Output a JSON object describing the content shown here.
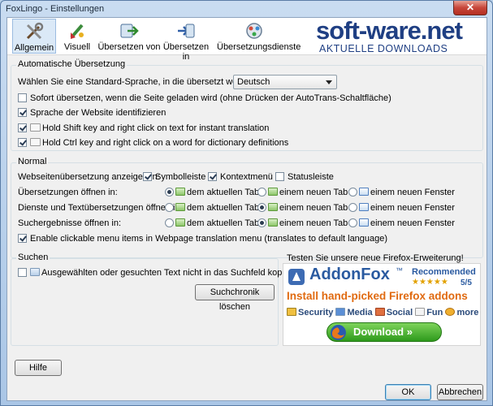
{
  "window": {
    "title": "FoxLingo - Einstellungen",
    "close_symbol": "✕"
  },
  "toolbar": {
    "items": [
      {
        "label": "Allgemein",
        "icon": "tools-icon"
      },
      {
        "label": "Visuell",
        "icon": "paint-brush-icon"
      },
      {
        "label": "Übersetzen von",
        "icon": "translate-from-icon"
      },
      {
        "label": "Übersetzen in",
        "icon": "translate-to-icon"
      },
      {
        "label": "Übersetzungsdienste",
        "icon": "services-icon"
      }
    ]
  },
  "brand": {
    "main": "soft-ware.net",
    "sub": "AKTUELLE DOWNLOADS"
  },
  "auto": {
    "legend": "Automatische Übersetzung",
    "default_lang_label": "Wählen Sie eine Standard-Sprache, in die übersetzt werden soll:",
    "default_lang_value": "Deutsch",
    "options": [
      {
        "label": "Sofort übersetzen, wenn die Seite geladen wird (ohne Drücken der AutoTrans-Schaltfläche)",
        "checked": false
      },
      {
        "label": "Sprache der Website identifizieren",
        "checked": true
      },
      {
        "label": "Hold Shift key and right click on text for instant translation",
        "checked": true
      },
      {
        "label": "Hold Ctrl key and right click on a word for dictionary definitions",
        "checked": true
      }
    ]
  },
  "normal": {
    "legend": "Normal",
    "web_label": "Webseitenübersetzung anzeigen in:",
    "web_options": [
      {
        "label": "Symbolleiste",
        "checked": true
      },
      {
        "label": "Kontextmenü",
        "checked": true
      },
      {
        "label": "Statusleiste",
        "checked": false
      }
    ],
    "radio_rows": [
      {
        "label": "Übersetzungen öffnen in:",
        "selected": 0
      },
      {
        "label": "Dienste und Textübersetzungen öffnen in:",
        "selected": 1
      },
      {
        "label": "Suchergebnisse öffnen in:",
        "selected": 1
      }
    ],
    "radio_options": [
      "dem aktuellen Tab",
      "einem neuen Tab",
      "einem neuen Fenster"
    ],
    "clickable_label": "Enable clickable menu items in Webpage translation menu (translates to default language)",
    "clickable_checked": true
  },
  "search": {
    "legend": "Suchen",
    "option_label": "Ausgewählten oder gesuchten Text nicht in das Suchfeld kopieren",
    "option_checked": false,
    "clear_button": "Suchchronik löschen"
  },
  "ad": {
    "caption": "Testen Sie unsere neue Firefox-Erweiterung!",
    "name": "AddonFox",
    "tm": "™",
    "recommended": "Recommended",
    "stars": "★★★★★",
    "rating": "5/5",
    "headline": "Install hand-picked Firefox addons",
    "features": [
      "Security",
      "Media",
      "Social",
      "Fun",
      "more"
    ],
    "download": "Download »"
  },
  "buttons": {
    "help": "Hilfe",
    "ok": "OK",
    "cancel": "Abbrechen"
  }
}
